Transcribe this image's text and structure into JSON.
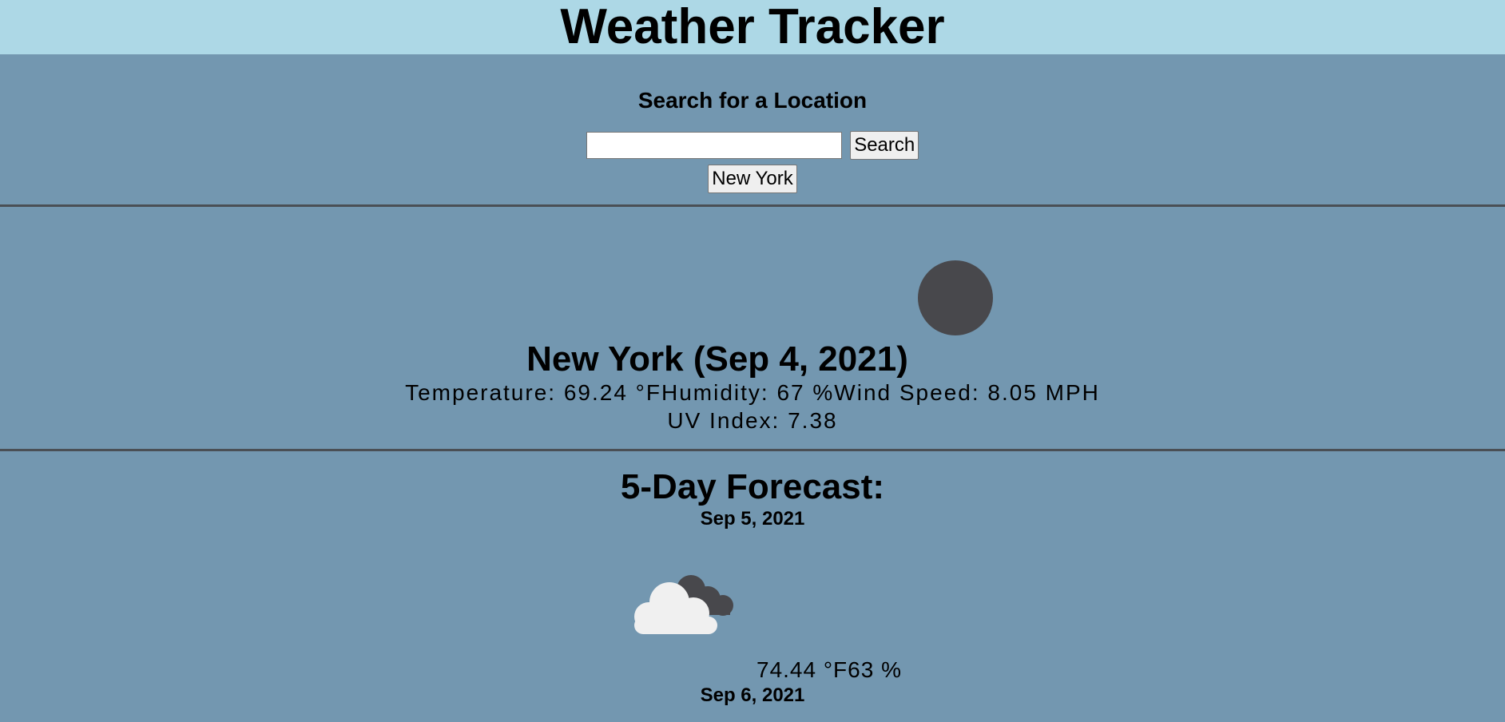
{
  "header": {
    "title": "Weather Tracker"
  },
  "search": {
    "heading": "Search for a Location",
    "input_value": "",
    "button_label": "Search",
    "history": [
      "New York"
    ]
  },
  "current": {
    "city_date": "New York (Sep 4, 2021)",
    "icon": "dark-circle-icon",
    "temperature": "Temperature: 69.24 °F",
    "humidity": "Humidity: 67 %",
    "wind": "Wind Speed: 8.05 MPH",
    "uv": "UV Index: 7.38"
  },
  "forecast": {
    "heading": "5-Day Forecast:",
    "days": [
      {
        "date": "Sep 5, 2021",
        "icon": "partly-cloudy-icon",
        "temp": "74.44 °F",
        "humidity": "63 %"
      },
      {
        "date": "Sep 6, 2021"
      }
    ]
  },
  "colors": {
    "header_bg": "#add8e6",
    "page_bg": "#7397b0",
    "divider": "#4a4f55",
    "icon_dark": "#48484c",
    "cloud_light": "#f0f0f0"
  }
}
